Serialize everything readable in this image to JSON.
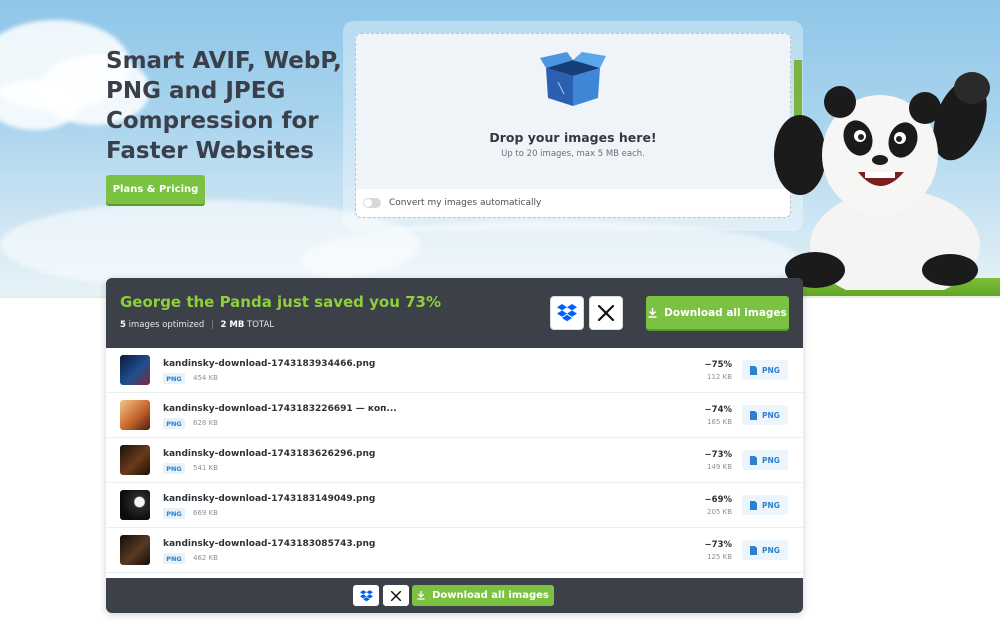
{
  "hero": {
    "headline": "Smart AVIF, WebP, PNG and JPEG Compression for Faster Websites",
    "plans_button": "Plans & Pricing"
  },
  "dropzone": {
    "title": "Drop your images here!",
    "subtitle": "Up to 20 images, max 5 MB each.",
    "auto_convert_label": "Convert my images automatically",
    "auto_convert_enabled": false
  },
  "results": {
    "title": "George the Panda just saved you 73%",
    "count": "5",
    "count_label": "images optimized",
    "total_size": "2 MB",
    "total_label": "TOTAL",
    "download_all_label": "Download all images",
    "files": [
      {
        "name": "kandinsky-download-1743183934466.png",
        "type": "PNG",
        "original_size": "454 KB",
        "savings": "−75%",
        "new_size": "112 KB",
        "action": "PNG"
      },
      {
        "name": "kandinsky-download-1743183226691 — коп...",
        "type": "PNG",
        "original_size": "628 KB",
        "savings": "−74%",
        "new_size": "165 KB",
        "action": "PNG"
      },
      {
        "name": "kandinsky-download-1743183626296.png",
        "type": "PNG",
        "original_size": "541 KB",
        "savings": "−73%",
        "new_size": "149 KB",
        "action": "PNG"
      },
      {
        "name": "kandinsky-download-1743183149049.png",
        "type": "PNG",
        "original_size": "669 KB",
        "savings": "−69%",
        "new_size": "205 KB",
        "action": "PNG"
      },
      {
        "name": "kandinsky-download-1743183085743.png",
        "type": "PNG",
        "original_size": "462 KB",
        "savings": "−73%",
        "new_size": "125 KB",
        "action": "PNG"
      }
    ]
  },
  "colors": {
    "accent_green": "#7cc242",
    "panel_dark": "#3c4048",
    "link_blue": "#2f7fcf"
  },
  "icons": [
    "dropbox-icon",
    "x-icon",
    "download-icon",
    "file-icon",
    "box-icon"
  ]
}
